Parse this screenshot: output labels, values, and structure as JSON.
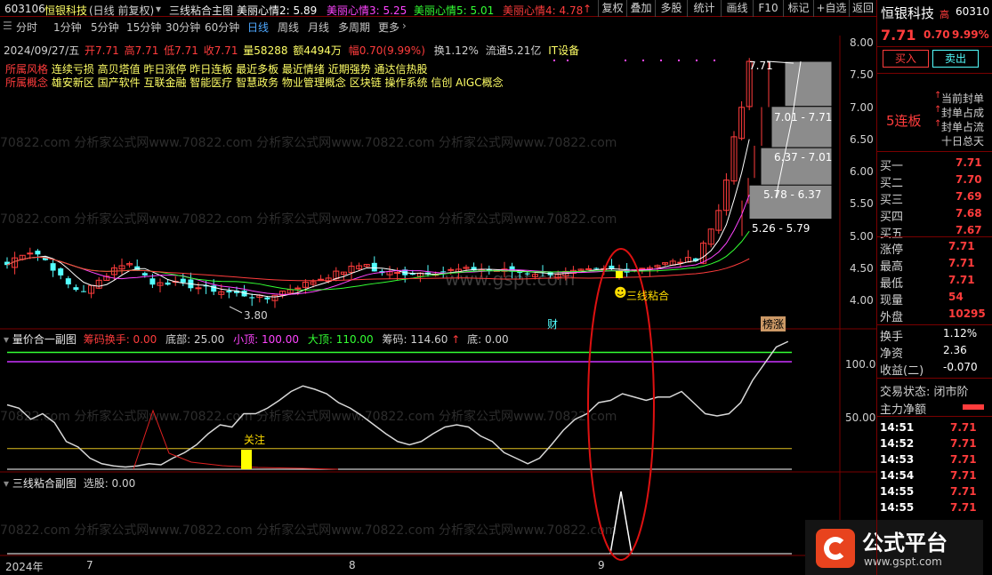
{
  "toolbar": {
    "stock_code": "603106",
    "stock_name": "恒银科技",
    "mode": "(日线 前复权)",
    "formula_name": "三线粘合主图",
    "mood_indicators": [
      "美丽心情2: 5.89",
      "美丽心情3: 5.25",
      "美丽心情5: 5.01",
      "美丽心情4: 4.78"
    ],
    "buttons": [
      "复权",
      "叠加",
      "多股",
      "统计",
      "画线",
      "F10",
      "标记",
      "+自选",
      "返回"
    ]
  },
  "periods": [
    "分时",
    "1分钟",
    "5分钟",
    "15分钟",
    "30分钟",
    "60分钟",
    "日线",
    "周线",
    "月线",
    "多周期",
    "更多"
  ],
  "active_period": "日线",
  "bar_info": {
    "date": "2024/09/27/五",
    "open": "开7.71",
    "high": "高7.71",
    "low": "低7.71",
    "close": "收7.71",
    "volume": "量58288",
    "amount": "额4494万",
    "change": "幅0.70(9.99%)",
    "turnover": "换1.12%",
    "float_cap": "流通5.21亿",
    "industry": "IT设备"
  },
  "tags": {
    "style_label": "所属风格",
    "style_items": "连续亏损 高贝塔值 昨日涨停 昨日连板 最近多板 最近情绪 近期强势 通达信热股",
    "concept_label": "所属概念",
    "concept_items": "雄安新区 国产软件 互联金融 智能医疗 智慧政务 物业管理概念 区块链 操作系统 信创 AIGC概念"
  },
  "watermarks": {
    "site": "70822.com 分析家公式网www.70822.com 分析家公式网www.70822.com 分析家公式网www.70822.com",
    "gspt": "www.gspt.com"
  },
  "y_axis": [
    "8.00",
    "7.50",
    "7.00",
    "6.50",
    "6.00",
    "5.50",
    "5.00",
    "4.50",
    "4.00"
  ],
  "price_zones": [
    "7.01 - 7.71",
    "6.37 - 7.01",
    "5.78 - 6.37",
    "5.26 - 5.79"
  ],
  "price_labels": {
    "high_marker": "7.71",
    "low_marker": "3.80",
    "signal": "三线粘合",
    "cai": "财",
    "bang": "榜涨"
  },
  "sub1": {
    "title": "量价合一副图",
    "values": [
      "筹码换手: 0.00",
      "底部: 25.00",
      "小顶: 100.00",
      "大顶: 110.00",
      "筹码: 114.60",
      "底: 0.00"
    ],
    "y_axis": [
      "100.0",
      "50.00"
    ],
    "focus": "关注"
  },
  "sub2": {
    "title": "三线粘合副图",
    "values": [
      "选股: 0.00"
    ]
  },
  "x_axis": [
    "2024年",
    "7",
    "8",
    "9"
  ],
  "chart_data": [
    {
      "type": "candlestick",
      "title": "三线粘合主图",
      "ylim": [
        3.6,
        8.1
      ],
      "y_ticks": [
        8.0,
        7.5,
        7.0,
        6.5,
        6.0,
        5.5,
        5.0,
        4.5,
        4.0
      ],
      "last_close": 7.71,
      "period_low": 3.8,
      "series": [
        {
          "name": "美丽心情2",
          "last": 5.89
        },
        {
          "name": "美丽心情3",
          "last": 5.25
        },
        {
          "name": "美丽心情5",
          "last": 5.01
        },
        {
          "name": "美丽心情4",
          "last": 4.78
        }
      ],
      "price_zones": [
        [
          7.01,
          7.71
        ],
        [
          6.37,
          7.01
        ],
        [
          5.78,
          6.37
        ],
        [
          5.26,
          5.79
        ]
      ]
    },
    {
      "type": "line",
      "title": "量价合一副图",
      "ylim": [
        0,
        120
      ],
      "y_ticks": [
        100,
        50
      ],
      "series": [
        {
          "name": "小顶",
          "values": [
            100
          ]
        },
        {
          "name": "大顶",
          "values": [
            110
          ]
        },
        {
          "name": "底部",
          "values": [
            25
          ]
        },
        {
          "name": "筹码",
          "last": 114.6
        },
        {
          "name": "筹码换手",
          "last": 0
        }
      ]
    },
    {
      "type": "line",
      "title": "三线粘合副图",
      "series": [
        {
          "name": "选股",
          "last": 0
        }
      ]
    }
  ],
  "quote": {
    "name": "恒银科技",
    "tag": "高",
    "code": "60310",
    "price": "7.71",
    "change": "0.70",
    "pct": "9.99%",
    "buy_btn": "买入",
    "sell_btn": "卖出",
    "board": "5连板",
    "notes": [
      "当前封单",
      "封单占成",
      "封单占流",
      "十日总天"
    ]
  },
  "order_book": [
    {
      "label": "买一",
      "price": "7.71"
    },
    {
      "label": "买二",
      "price": "7.70"
    },
    {
      "label": "买三",
      "price": "7.69"
    },
    {
      "label": "买四",
      "price": "7.68"
    },
    {
      "label": "买五",
      "price": "7.67"
    }
  ],
  "stats": [
    {
      "label": "涨停",
      "value": "7.71"
    },
    {
      "label": "最高",
      "value": "7.71"
    },
    {
      "label": "最低",
      "value": "7.71"
    },
    {
      "label": "现量",
      "value": "54"
    },
    {
      "label": "外盘",
      "value": "10295"
    }
  ],
  "stats2": [
    {
      "label": "换手",
      "value": "1.12%"
    },
    {
      "label": "净资",
      "value": "2.36"
    },
    {
      "label": "收益(二)",
      "value": "-0.070"
    }
  ],
  "status": {
    "trade": "交易状态: 闭市阶",
    "main_flow": "主力净额"
  },
  "ticks": [
    {
      "time": "14:51",
      "price": "7.71"
    },
    {
      "time": "14:52",
      "price": "7.71"
    },
    {
      "time": "14:53",
      "price": "7.71"
    },
    {
      "time": "14:54",
      "price": "7.71"
    },
    {
      "time": "14:55",
      "price": "7.71"
    },
    {
      "time": "14:55",
      "price": "7.71"
    }
  ],
  "logo": {
    "text": "公式平台",
    "url": "www.gspt.com"
  },
  "colors": {
    "bg": "#000000",
    "up": "#ff3c3c",
    "down": "#54ffff",
    "yellow": "#ffff00",
    "magenta": "#ff44ff",
    "green": "#33ff33",
    "grid": "#7a0000"
  }
}
